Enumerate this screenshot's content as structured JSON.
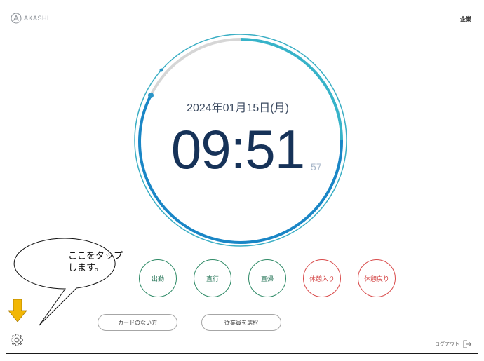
{
  "header": {
    "brand": "AKASHI",
    "company": "企業"
  },
  "clock": {
    "date": "2024年01月15日(月)",
    "time": "09:51",
    "seconds": "57",
    "accent_color": "#1a86c6",
    "ring_color": "#37b3c9"
  },
  "punch_buttons": [
    {
      "label": "出勤",
      "style": "green"
    },
    {
      "label": "直行",
      "style": "green"
    },
    {
      "label": "直帰",
      "style": "green"
    },
    {
      "label": "休憩入り",
      "style": "red"
    },
    {
      "label": "休憩戻り",
      "style": "red"
    }
  ],
  "secondary_buttons": {
    "no_card": "カードのない方",
    "select_employee": "従業員を選択"
  },
  "footer": {
    "logout": "ログアウト"
  },
  "annotation": {
    "line1": "ここをタップ",
    "line2": "します。",
    "arrow_color": "#f2b705"
  }
}
